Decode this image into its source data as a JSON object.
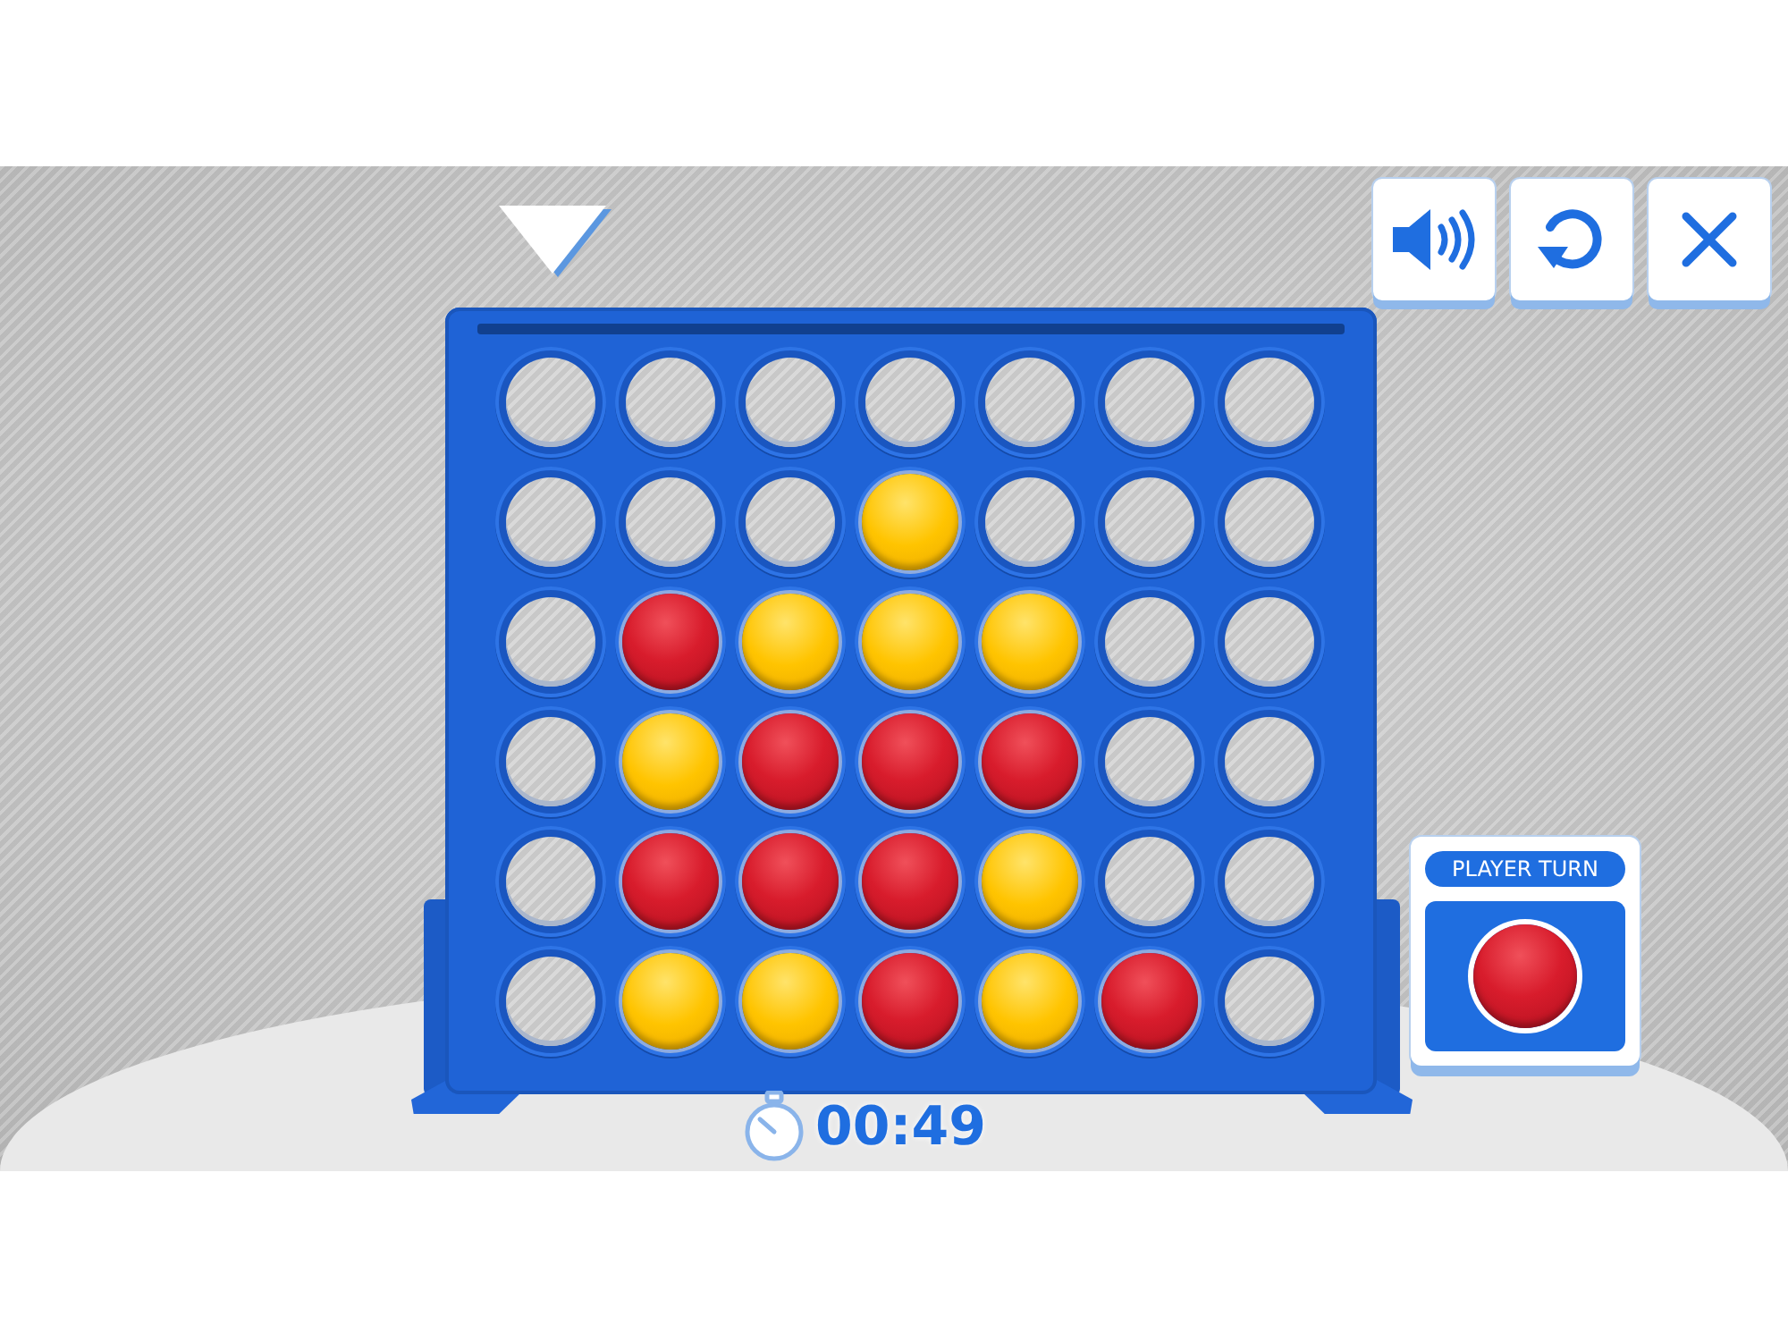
{
  "columns": [
    {
      "selected": true
    },
    {
      "selected": false
    },
    {
      "selected": false
    },
    {
      "selected": false
    },
    {
      "selected": false
    },
    {
      "selected": false
    },
    {
      "selected": false
    }
  ],
  "toolbar": [
    {
      "kind": "sound"
    },
    {
      "kind": "restart"
    },
    {
      "kind": "close"
    }
  ],
  "board": {
    "rows": [
      {
        "cells": [
          {
            "kind": "empty"
          },
          {
            "kind": "empty"
          },
          {
            "kind": "empty"
          },
          {
            "kind": "empty"
          },
          {
            "kind": "empty"
          },
          {
            "kind": "empty"
          },
          {
            "kind": "empty"
          }
        ]
      },
      {
        "cells": [
          {
            "kind": "empty"
          },
          {
            "kind": "empty"
          },
          {
            "kind": "empty"
          },
          {
            "kind": "yellow"
          },
          {
            "kind": "empty"
          },
          {
            "kind": "empty"
          },
          {
            "kind": "empty"
          }
        ]
      },
      {
        "cells": [
          {
            "kind": "empty"
          },
          {
            "kind": "red"
          },
          {
            "kind": "yellow"
          },
          {
            "kind": "yellow"
          },
          {
            "kind": "yellow"
          },
          {
            "kind": "empty"
          },
          {
            "kind": "empty"
          }
        ]
      },
      {
        "cells": [
          {
            "kind": "empty"
          },
          {
            "kind": "yellow"
          },
          {
            "kind": "red"
          },
          {
            "kind": "red"
          },
          {
            "kind": "red"
          },
          {
            "kind": "empty"
          },
          {
            "kind": "empty"
          }
        ]
      },
      {
        "cells": [
          {
            "kind": "empty"
          },
          {
            "kind": "red"
          },
          {
            "kind": "red"
          },
          {
            "kind": "red"
          },
          {
            "kind": "yellow"
          },
          {
            "kind": "empty"
          },
          {
            "kind": "empty"
          }
        ]
      },
      {
        "cells": [
          {
            "kind": "empty"
          },
          {
            "kind": "yellow"
          },
          {
            "kind": "yellow"
          },
          {
            "kind": "red"
          },
          {
            "kind": "yellow"
          },
          {
            "kind": "red"
          },
          {
            "kind": "empty"
          }
        ]
      }
    ]
  },
  "player_turn": {
    "label": "PLAYER TURN",
    "disc": {
      "kind": "red"
    }
  },
  "timer": {
    "time": "00:49"
  }
}
